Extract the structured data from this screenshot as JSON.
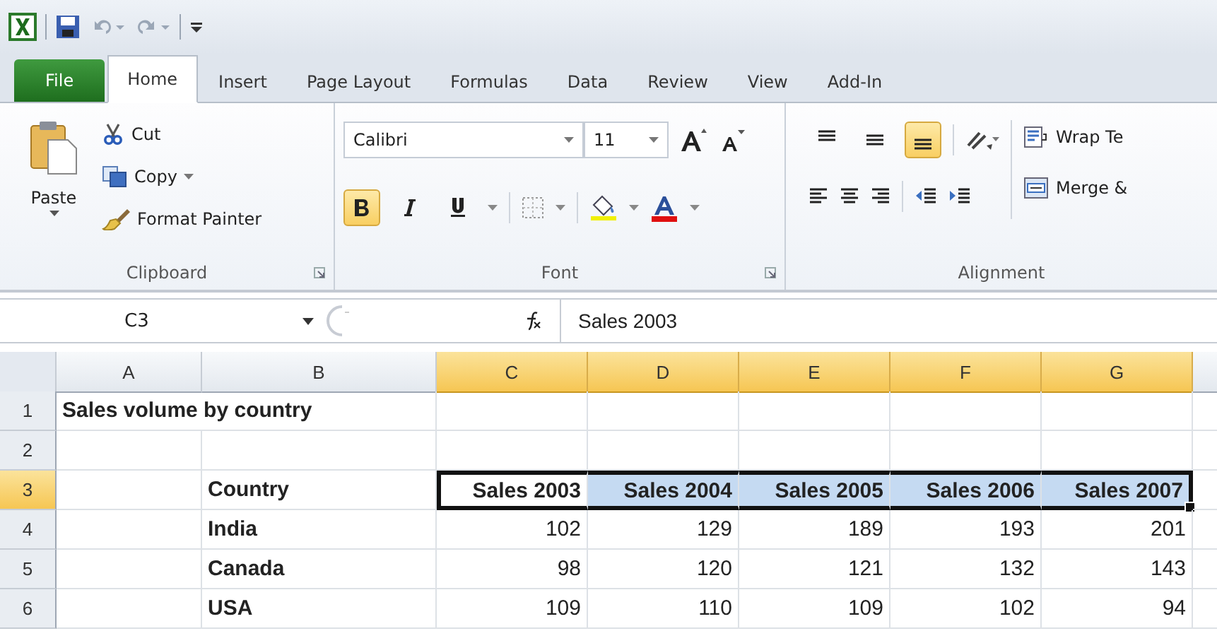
{
  "tabs": [
    {
      "label": "File",
      "kind": "file",
      "selected": false
    },
    {
      "label": "Home",
      "kind": "tab",
      "selected": true
    },
    {
      "label": "Insert",
      "kind": "tab",
      "selected": false
    },
    {
      "label": "Page Layout",
      "kind": "tab",
      "selected": false
    },
    {
      "label": "Formulas",
      "kind": "tab",
      "selected": false
    },
    {
      "label": "Data",
      "kind": "tab",
      "selected": false
    },
    {
      "label": "Review",
      "kind": "tab",
      "selected": false
    },
    {
      "label": "View",
      "kind": "tab",
      "selected": false
    },
    {
      "label": "Add-In",
      "kind": "tab",
      "selected": false
    }
  ],
  "clipboard": {
    "label": "Clipboard",
    "paste": "Paste",
    "cut": "Cut",
    "copy": "Copy",
    "format_painter": "Format Painter"
  },
  "font": {
    "label": "Font",
    "font_name": "Calibri",
    "font_size": "11",
    "bold": true,
    "italic": false,
    "underline": false
  },
  "alignment": {
    "label": "Alignment",
    "top_align": false,
    "middle_align": false,
    "bottom_align": true,
    "wrap_text": "Wrap Te",
    "merge": "Merge &"
  },
  "formula_bar": {
    "name_box": "C3",
    "formula": "Sales 2003"
  },
  "sheet": {
    "columns": [
      {
        "label": "A",
        "selected": false
      },
      {
        "label": "B",
        "selected": false
      },
      {
        "label": "C",
        "selected": true
      },
      {
        "label": "D",
        "selected": true
      },
      {
        "label": "E",
        "selected": true
      },
      {
        "label": "F",
        "selected": true
      },
      {
        "label": "G",
        "selected": true
      }
    ],
    "rows": [
      {
        "number": "1",
        "selected": false,
        "kind": "title",
        "title": "Sales volume by country"
      },
      {
        "number": "2",
        "selected": false,
        "kind": "blank"
      },
      {
        "number": "3",
        "selected": true,
        "kind": "header",
        "country": "Country",
        "values": [
          "Sales 2003",
          "Sales 2004",
          "Sales 2005",
          "Sales 2006",
          "Sales 2007"
        ]
      },
      {
        "number": "4",
        "selected": false,
        "kind": "data",
        "country": "India",
        "values": [
          "102",
          "129",
          "189",
          "193",
          "201"
        ]
      },
      {
        "number": "5",
        "selected": false,
        "kind": "data",
        "country": "Canada",
        "values": [
          "98",
          "120",
          "121",
          "132",
          "143"
        ]
      },
      {
        "number": "6",
        "selected": false,
        "kind": "data",
        "country": "USA",
        "values": [
          "109",
          "110",
          "109",
          "102",
          "94"
        ]
      }
    ]
  }
}
